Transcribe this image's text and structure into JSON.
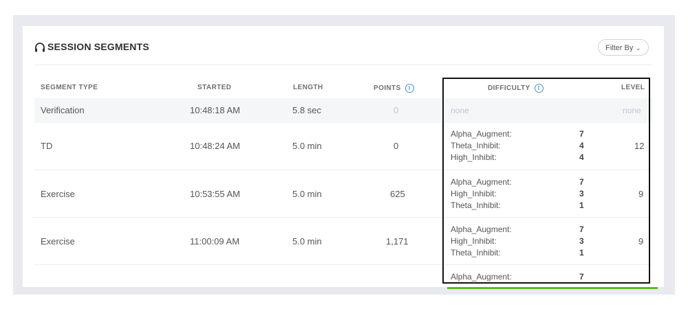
{
  "header": {
    "title": "SESSION SEGMENTS",
    "filter_label": "Filter By",
    "filter_caret": "⌄"
  },
  "columns": {
    "segment_type": "SEGMENT TYPE",
    "started": "STARTED",
    "length": "LENGTH",
    "points": "POINTS",
    "difficulty": "DIFFICULTY",
    "level": "LEVEL"
  },
  "info_glyph": "i",
  "rows": [
    {
      "type": "Verification",
      "started": "10:48:18 AM",
      "length": "5.8 sec",
      "points": "0",
      "difficulty_text": "none",
      "level": "none"
    },
    {
      "type": "TD",
      "started": "10:48:24 AM",
      "length": "5.0 min",
      "points": "0",
      "difficulty": [
        {
          "name": "Alpha_Augment:",
          "value": "7"
        },
        {
          "name": "Theta_Inhibit:",
          "value": "4"
        },
        {
          "name": "High_Inhibit:",
          "value": "4"
        }
      ],
      "level": "12"
    },
    {
      "type": "Exercise",
      "started": "10:53:55 AM",
      "length": "5.0 min",
      "points": "625",
      "difficulty": [
        {
          "name": "Alpha_Augment:",
          "value": "7"
        },
        {
          "name": "High_Inhibit:",
          "value": "3"
        },
        {
          "name": "Theta_Inhibit:",
          "value": "1"
        }
      ],
      "level": "9"
    },
    {
      "type": "Exercise",
      "started": "11:00:09 AM",
      "length": "5.0 min",
      "points": "1,171",
      "difficulty": [
        {
          "name": "Alpha_Augment:",
          "value": "7"
        },
        {
          "name": "High_Inhibit:",
          "value": "3"
        },
        {
          "name": "Theta_Inhibit:",
          "value": "1"
        }
      ],
      "level": "9"
    },
    {
      "difficulty": [
        {
          "name": "Alpha_Augment:",
          "value": "7"
        }
      ]
    }
  ],
  "colors": {
    "highlight_green": "#5dbb23",
    "highlight_border": "#111111",
    "info_blue": "#4a90d9",
    "band_gray": "#e9eaef"
  },
  "icons": {
    "title_icon": "headset-icon",
    "info": "info-circle-icon",
    "caret": "chevron-down-icon"
  }
}
